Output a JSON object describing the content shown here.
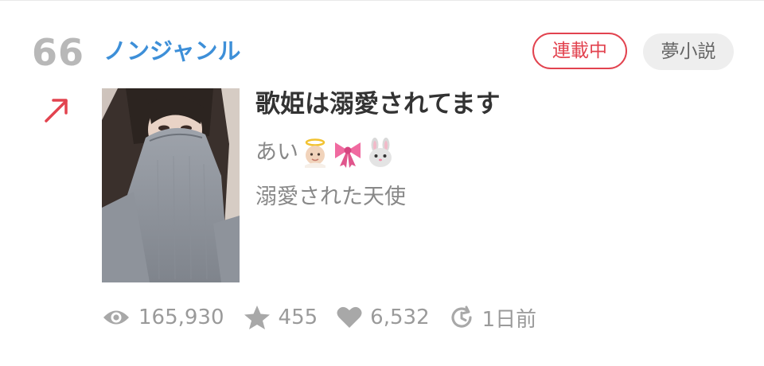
{
  "rank": "66",
  "genre": "ノンジャンル",
  "trend_icon": "arrow-up-right-icon",
  "badges": {
    "serial": "連載中",
    "category": "夢小説"
  },
  "work": {
    "title": "歌姫は溺愛されてます",
    "author": "あい",
    "author_emojis": [
      "baby-angel-icon",
      "ribbon-icon",
      "rabbit-face-icon"
    ],
    "description": "溺愛された天使"
  },
  "stats": {
    "views": "165,930",
    "stars": "455",
    "likes": "6,532",
    "updated": "1日前"
  },
  "colors": {
    "rank": "#b8b8b8",
    "genre": "#3d8fd8",
    "accent_red": "#e2434f",
    "muted_text": "#888888"
  }
}
